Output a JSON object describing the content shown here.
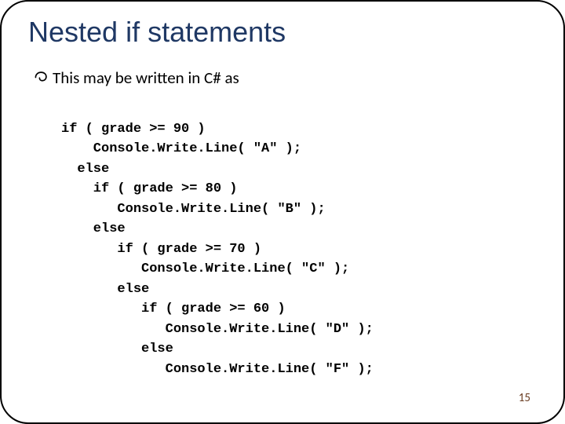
{
  "title": "Nested if statements",
  "bullet1": "This may be written in C# as",
  "code": {
    "l1": "if ( grade >= 90 )",
    "l2": "    Console.Write.Line( \"A\" );",
    "l3": "  else",
    "l4": "    if ( grade >= 80 )",
    "l5": "       Console.Write.Line( \"B\" );",
    "l6": "    else",
    "l7": "       if ( grade >= 70 )",
    "l8": "          Console.Write.Line( \"C\" );",
    "l9": "       else",
    "l10": "          if ( grade >= 60 )",
    "l11": "             Console.Write.Line( \"D\" );",
    "l12": "          else",
    "l13": "             Console.Write.Line( \"F\" );"
  },
  "pageNumber": "15"
}
